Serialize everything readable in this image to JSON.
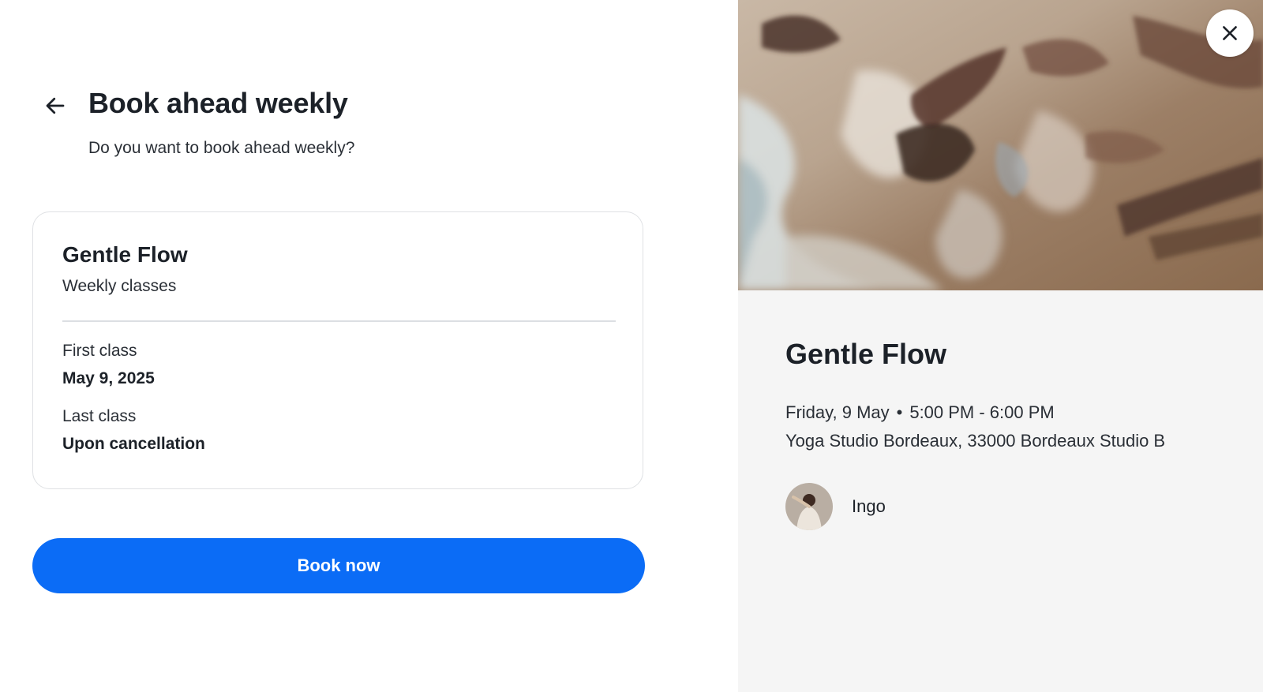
{
  "booking": {
    "title": "Book ahead weekly",
    "subtitle": "Do you want to book ahead weekly?",
    "card": {
      "class_name": "Gentle Flow",
      "class_type": "Weekly classes",
      "first_class_label": "First class",
      "first_class_value": "May 9, 2025",
      "last_class_label": "Last class",
      "last_class_value": "Upon cancellation"
    },
    "cta_label": "Book now",
    "back_icon": "arrow-left-icon"
  },
  "details": {
    "title": "Gentle Flow",
    "day": "Friday, 9 May",
    "separator": "•",
    "time": "5:00 PM - 6:00 PM",
    "location": "Yoga Studio Bordeaux, 33000 Bordeaux Studio B",
    "instructor": "Ingo",
    "close_icon": "close-icon"
  },
  "colors": {
    "primary": "#0b6cf6",
    "panel_bg": "#f5f5f5",
    "text": "#1c2128"
  }
}
